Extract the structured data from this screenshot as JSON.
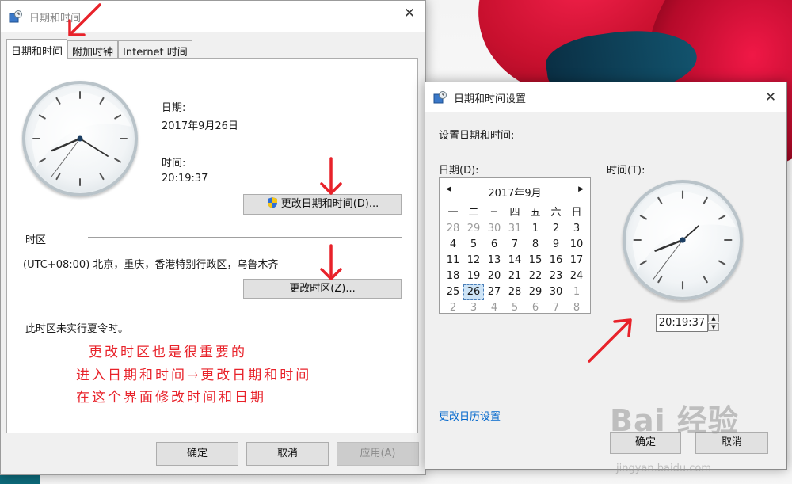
{
  "desktop": {
    "accent_colors": [
      "#c8102e",
      "#0a2f44"
    ]
  },
  "dlg1": {
    "title": "日期和时间",
    "tabs": [
      "日期和时间",
      "附加时钟",
      "Internet 时间"
    ],
    "date_label": "日期:",
    "date_value": "2017年9月26日",
    "time_label": "时间:",
    "time_value": "20:19:37",
    "change_datetime_button": "更改日期和时间(D)...",
    "timezone_heading": "时区",
    "timezone_value": "(UTC+08:00) 北京，重庆，香港特别行政区，乌鲁木齐",
    "change_timezone_button": "更改时区(Z)...",
    "dst_note": "此时区未实行夏令时。",
    "ok_button": "确定",
    "cancel_button": "取消",
    "apply_button": "应用(A)",
    "close_glyph": "✕"
  },
  "dlg2": {
    "title": "日期和时间设置",
    "subtitle": "设置日期和时间:",
    "date_label": "日期(D):",
    "time_label": "时间(T):",
    "calendar": {
      "month": "2017年9月",
      "prev_glyph": "◀",
      "next_glyph": "▶",
      "weekdays": [
        "一",
        "二",
        "三",
        "四",
        "五",
        "六",
        "日"
      ],
      "weeks": [
        [
          "28",
          "29",
          "30",
          "31",
          "1",
          "2",
          "3"
        ],
        [
          "4",
          "5",
          "6",
          "7",
          "8",
          "9",
          "10"
        ],
        [
          "11",
          "12",
          "13",
          "14",
          "15",
          "16",
          "17"
        ],
        [
          "18",
          "19",
          "20",
          "21",
          "22",
          "23",
          "24"
        ],
        [
          "25",
          "26",
          "27",
          "28",
          "29",
          "30",
          "1"
        ],
        [
          "2",
          "3",
          "4",
          "5",
          "6",
          "7",
          "8"
        ]
      ],
      "selected": "26"
    },
    "time_value": "20:19:37",
    "spin_up": "▲",
    "spin_down": "▼",
    "calendar_link": "更改日历设置",
    "ok_button": "确定",
    "cancel_button": "取消",
    "close_glyph": "✕"
  },
  "annotation": {
    "lines": [
      "更改时区也是很重要的",
      "进入日期和时间→更改日期和时间",
      "在这个界面修改时间和日期"
    ]
  },
  "watermark": {
    "logo": "Bai 经验",
    "url": "jingyan.baidu.com"
  }
}
